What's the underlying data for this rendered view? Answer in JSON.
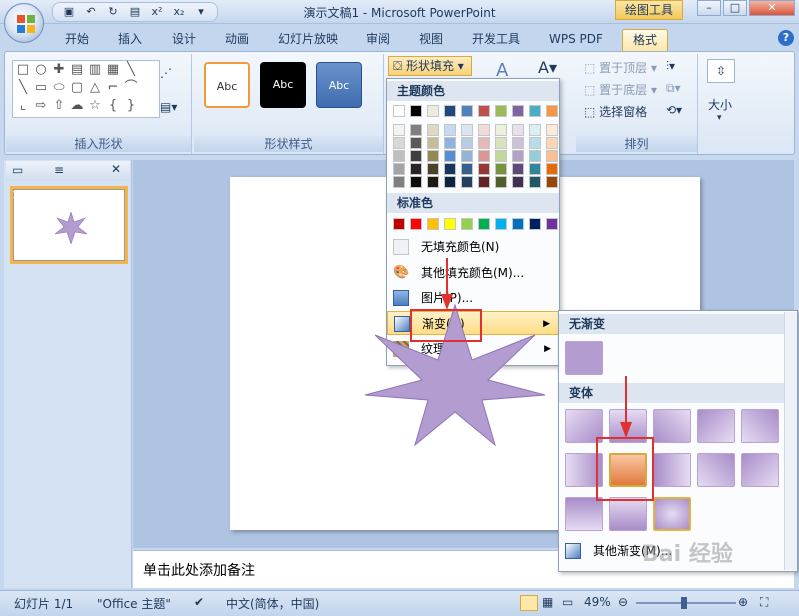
{
  "window": {
    "title": "演示文稿1 - Microsoft PowerPoint",
    "context_tab": "绘图工具"
  },
  "tabs": [
    "开始",
    "插入",
    "设计",
    "动画",
    "幻灯片放映",
    "审阅",
    "视图",
    "开发工具",
    "WPS PDF",
    "格式"
  ],
  "ribbon": {
    "groups": {
      "insert_shapes": "插入形状",
      "shape_styles": "形状样式",
      "arrange": "排列"
    },
    "style_samples": [
      "Abc",
      "Abc",
      "Abc"
    ],
    "fill_button": "形状填充",
    "arrange": {
      "bring_front": "置于顶层",
      "send_back": "置于底层",
      "selection_pane": "选择窗格"
    },
    "size": "大小"
  },
  "fill_menu": {
    "theme_colors": "主题颜色",
    "standard_colors": "标准色",
    "no_fill": "无填充颜色(N)",
    "more_colors": "其他填充颜色(M)...",
    "picture": "图片(P)...",
    "gradient": "渐变(G)",
    "texture": "纹理(T)"
  },
  "gradient_submenu": {
    "no_gradient": "无渐变",
    "variants": "变体",
    "more": "其他渐变(M)..."
  },
  "slide_panel": {
    "slide_number": "1"
  },
  "notes_placeholder": "单击此处添加备注",
  "statusbar": {
    "slide": "幻灯片 1/1",
    "theme": "\"Office 主题\"",
    "language": "中文(简体，中国)",
    "zoom": "49%"
  },
  "watermark": "Bai 经验",
  "colors": {
    "accent": "#f6b44b",
    "star": "#b39cd0",
    "highlight": "#e03030"
  }
}
